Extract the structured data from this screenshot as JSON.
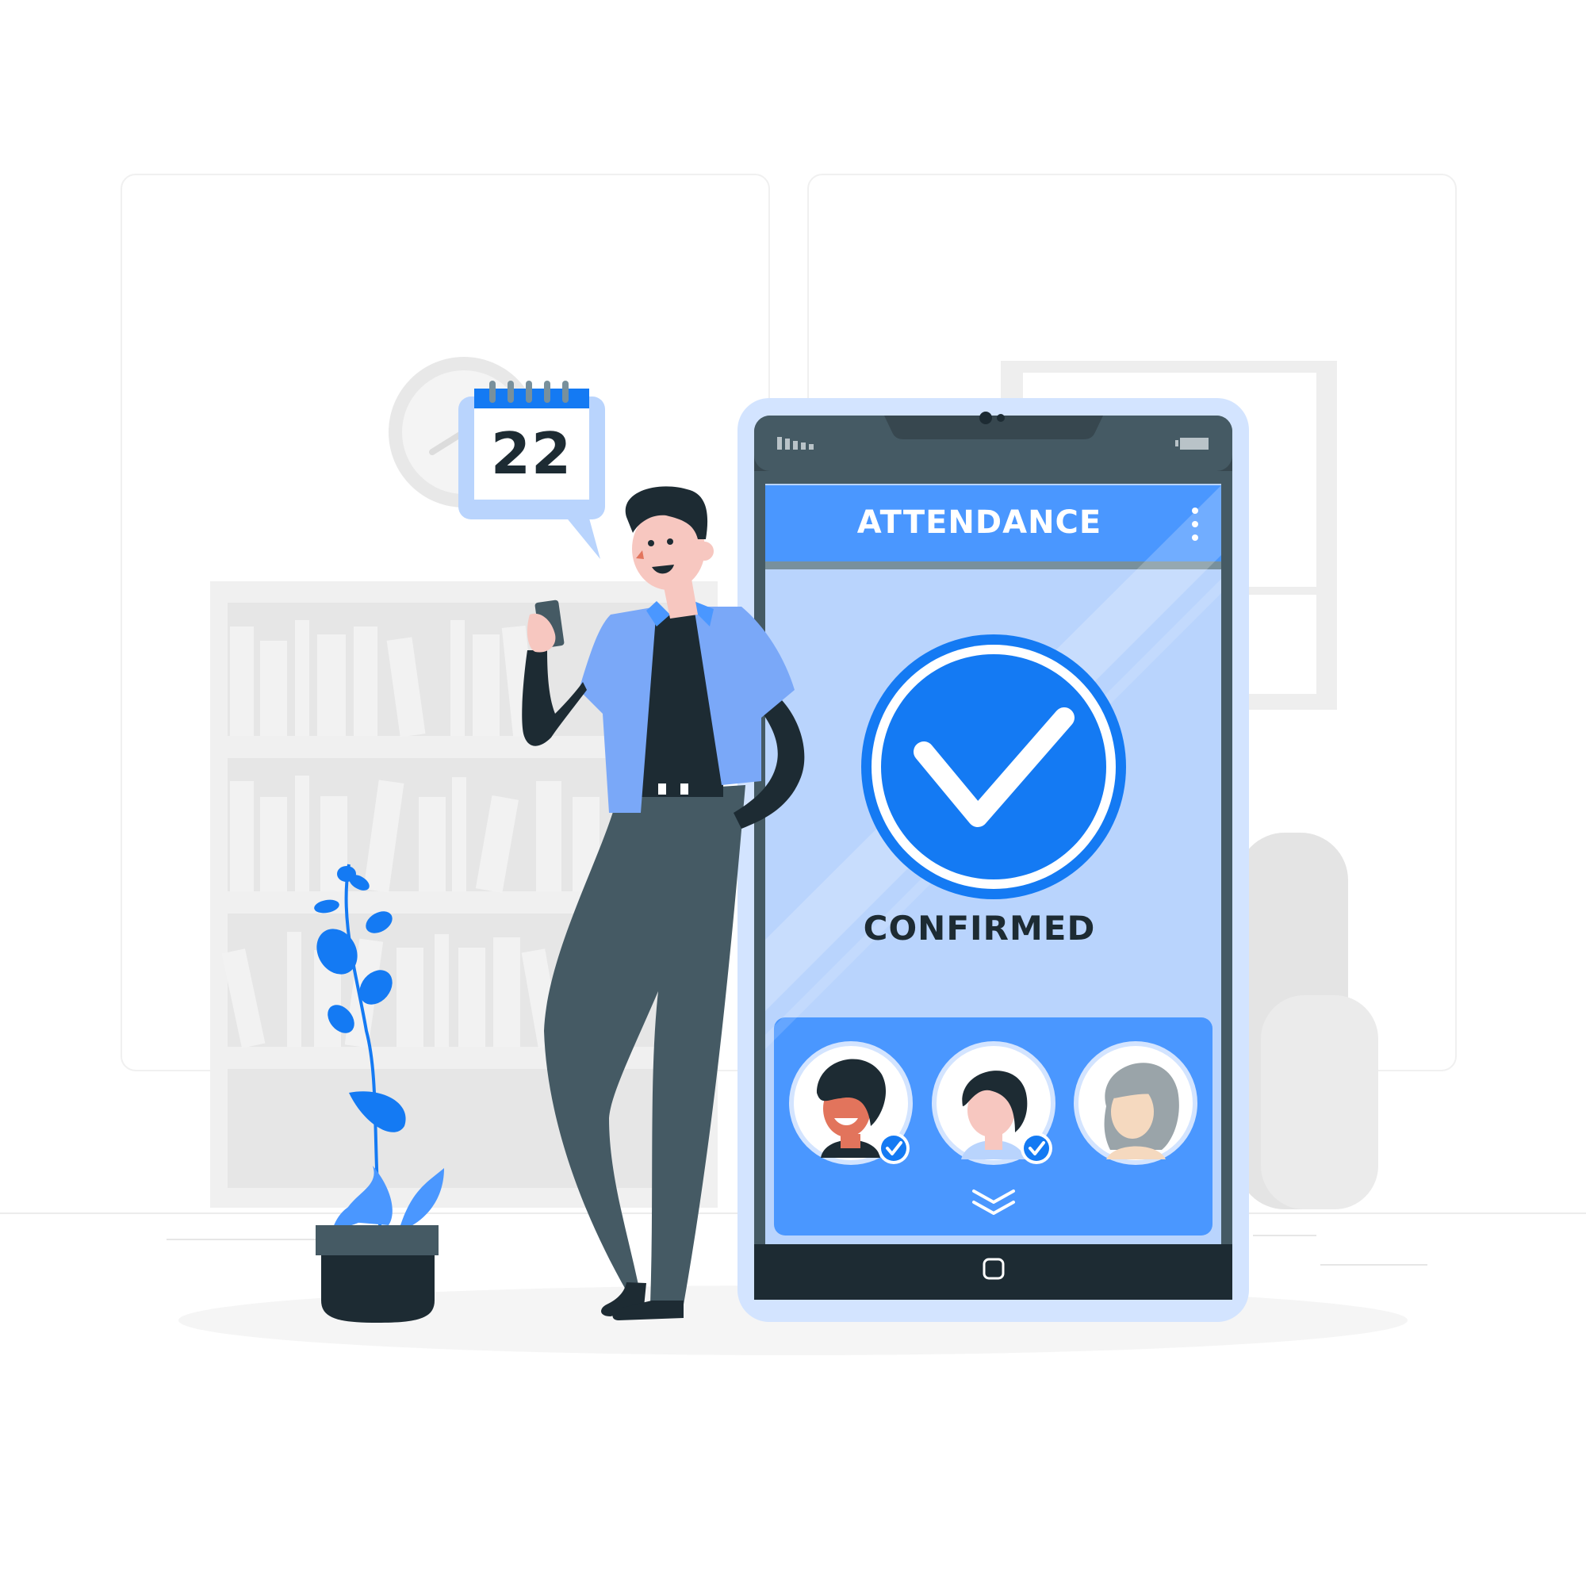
{
  "calendar": {
    "day": "22"
  },
  "phone_app": {
    "title": "ATTENDANCE",
    "status": "CONFIRMED",
    "attendees": [
      {
        "name": "attendee-1",
        "confirmed": true
      },
      {
        "name": "attendee-2",
        "confirmed": true
      },
      {
        "name": "attendee-3",
        "confirmed": false
      }
    ]
  },
  "icons": {
    "menu": "vertical-dots-icon",
    "confirm": "checkmark-icon",
    "expand": "double-chevron-down-icon",
    "home": "home-button-icon",
    "signal": "signal-icon",
    "battery": "battery-icon"
  },
  "colors": {
    "accent": "#4a97ff",
    "primary_blue": "#147af3",
    "light_blue": "#b9d4fd",
    "dark": "#1d2b33",
    "phone_frame": "#455a64",
    "background_gray": "#eeeeee"
  }
}
